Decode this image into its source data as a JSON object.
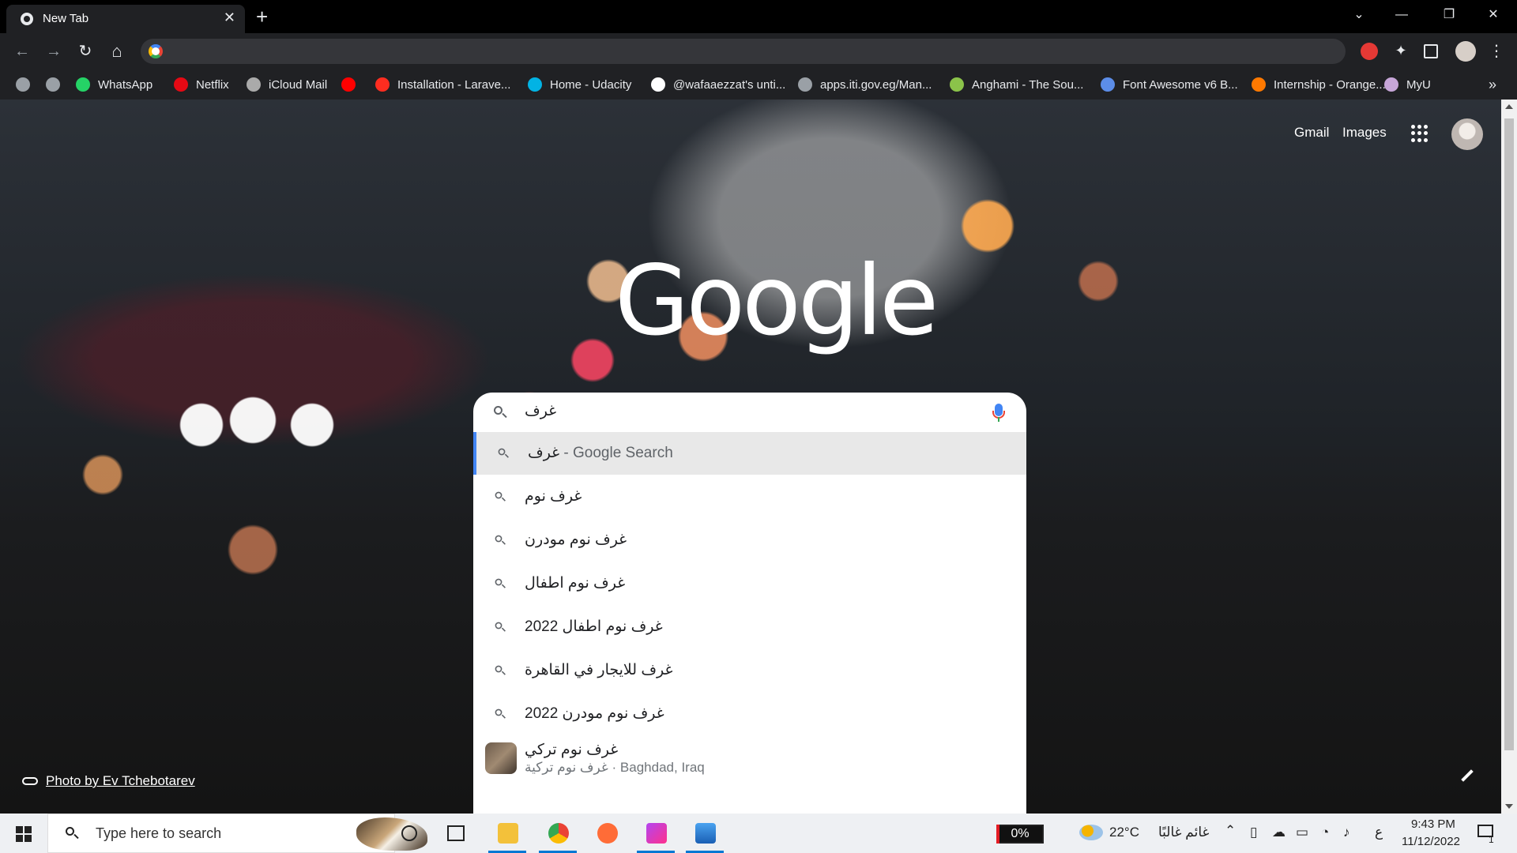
{
  "browser": {
    "tab_title": "New Tab",
    "tab_close": "✕",
    "new_tab": "+",
    "window_controls": {
      "dropdown": "⌄",
      "minimize": "—",
      "restore": "❐",
      "close": "✕"
    },
    "nav": {
      "back": "←",
      "forward": "→",
      "reload": "↻",
      "home": "⌂"
    },
    "menu_dots": "⋮"
  },
  "bookmarks": [
    {
      "label": "",
      "icon": "globe-icon",
      "color": "#9aa0a6"
    },
    {
      "label": "",
      "icon": "globe-icon",
      "color": "#9aa0a6"
    },
    {
      "label": "WhatsApp",
      "icon": "whatsapp-icon",
      "color": "#25d366"
    },
    {
      "label": "Netflix",
      "icon": "netflix-icon",
      "color": "#e50914"
    },
    {
      "label": "iCloud Mail",
      "icon": "apple-icon",
      "color": "#aaaaaa"
    },
    {
      "label": "",
      "icon": "youtube-icon",
      "color": "#ff0000"
    },
    {
      "label": "Installation - Larave...",
      "icon": "laravel-icon",
      "color": "#ff2d20"
    },
    {
      "label": "Home - Udacity",
      "icon": "udacity-icon",
      "color": "#02b3e4"
    },
    {
      "label": "@wafaaezzat's unti...",
      "icon": "github-icon",
      "color": "#ffffff"
    },
    {
      "label": "apps.iti.gov.eg/Man...",
      "icon": "globe-icon",
      "color": "#9aa0a6"
    },
    {
      "label": "Anghami - The Sou...",
      "icon": "anghami-icon",
      "color": "#8bc34a"
    },
    {
      "label": "Font Awesome v6 B...",
      "icon": "flag-icon",
      "color": "#5c8de8"
    },
    {
      "label": "Internship - Orange...",
      "icon": "orange-icon",
      "color": "#ff7900"
    },
    {
      "label": "MyU",
      "icon": "myu-icon",
      "color": "#c7a6d8"
    }
  ],
  "bookmarks_overflow": "»",
  "ntp": {
    "gmail": "Gmail",
    "images": "Images",
    "logo": "Google",
    "query": "غرف",
    "suggestions": [
      {
        "text": "غرف",
        "suffix": " - Google Search",
        "active": true
      },
      {
        "text": "غرف نوم"
      },
      {
        "text": "غرف نوم مودرن"
      },
      {
        "text": "غرف نوم اطفال"
      },
      {
        "text": "غرف نوم اطفال 2022"
      },
      {
        "text": "غرف للايجار في القاهرة"
      },
      {
        "text": "غرف نوم مودرن 2022"
      },
      {
        "text": "غرف نوم تركي",
        "subtitle": "غرف نوم تركية · Baghdad, Iraq",
        "thumbnail": true
      }
    ],
    "attribution": "Photo by Ev Tchebotarev"
  },
  "taskbar": {
    "search_placeholder": "Type here to search",
    "battery": "0%",
    "temperature": "22°C",
    "weather": "غائم غالبًا",
    "lang": "ع",
    "time": "9:43 PM",
    "date": "11/12/2022",
    "notif_count": "1"
  }
}
